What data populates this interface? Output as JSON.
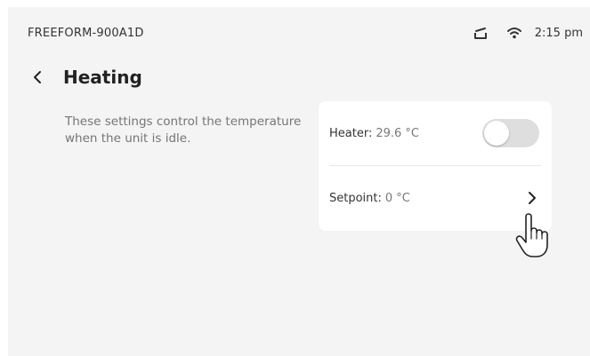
{
  "status_bar": {
    "device_name": "FREEFORM-900A1D",
    "time": "2:15 pm",
    "icons": [
      "tray-icon",
      "wifi-icon"
    ]
  },
  "header": {
    "back_icon": "chevron-left-icon",
    "title": "Heating"
  },
  "description": "These settings control the temperature when the unit is idle.",
  "settings": {
    "heater": {
      "label": "Heater:",
      "value": "29.6 °C",
      "toggle_on": false
    },
    "setpoint": {
      "label": "Setpoint:",
      "value": "0 °C",
      "icon": "chevron-right-icon"
    }
  },
  "colors": {
    "background": "#f4f4f4",
    "card": "#ffffff",
    "toggle_track": "#dedede",
    "text_primary": "#333333",
    "text_muted": "#757575"
  }
}
